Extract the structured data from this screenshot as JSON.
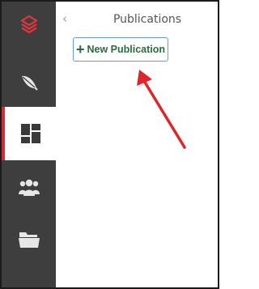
{
  "sidebar": {
    "items": [
      {
        "name": "logo",
        "icon": "app-logo-icon",
        "active": false
      },
      {
        "name": "feather",
        "icon": "feather-icon",
        "active": false
      },
      {
        "name": "dashboard",
        "icon": "dashboard-icon",
        "active": true
      },
      {
        "name": "users",
        "icon": "users-group-icon",
        "active": false
      },
      {
        "name": "folder",
        "icon": "folder-icon",
        "active": false
      }
    ],
    "accent": "#d62b3b",
    "background": "#3e3e3e"
  },
  "panel": {
    "collapse_glyph": "‹",
    "title": "Publications",
    "new_button": {
      "plus": "+",
      "label": "New Publication"
    }
  },
  "annotation": {
    "arrow_color": "#e0242b"
  }
}
